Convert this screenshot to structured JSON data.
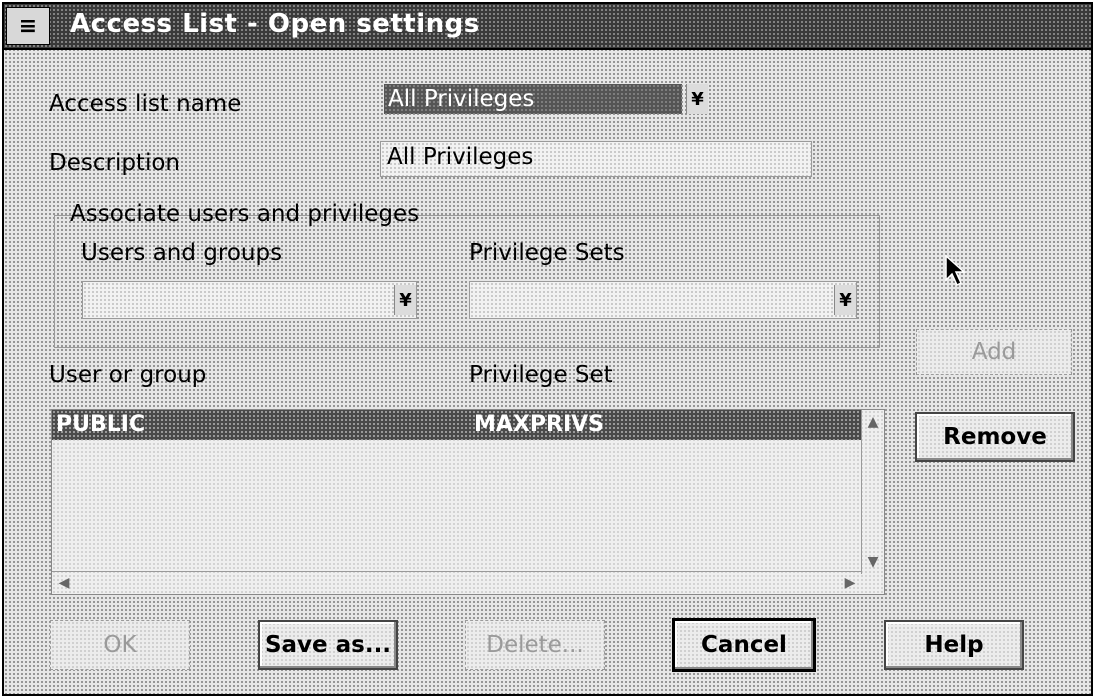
{
  "window": {
    "title": "Access List - Open settings",
    "sysmenu_icon": "≡"
  },
  "form": {
    "access_list_name_label": "Access list name",
    "access_list_name_value": "All Privileges",
    "description_label": "Description",
    "description_value": "All Privileges",
    "group_label": "Associate users and privileges",
    "users_groups_label": "Users and groups",
    "users_groups_value": "",
    "privilege_sets_label": "Privilege Sets",
    "privilege_sets_value": "",
    "dropdown_glyph": "¥"
  },
  "list": {
    "col_user": "User or group",
    "col_privilege": "Privilege Set",
    "rows": [
      {
        "user": "PUBLIC",
        "privilege": "MAXPRIVS",
        "selected": true
      }
    ]
  },
  "buttons": {
    "add": "Add",
    "remove": "Remove",
    "ok": "OK",
    "save_as": "Save as...",
    "delete": "Delete...",
    "cancel": "Cancel",
    "help": "Help"
  }
}
